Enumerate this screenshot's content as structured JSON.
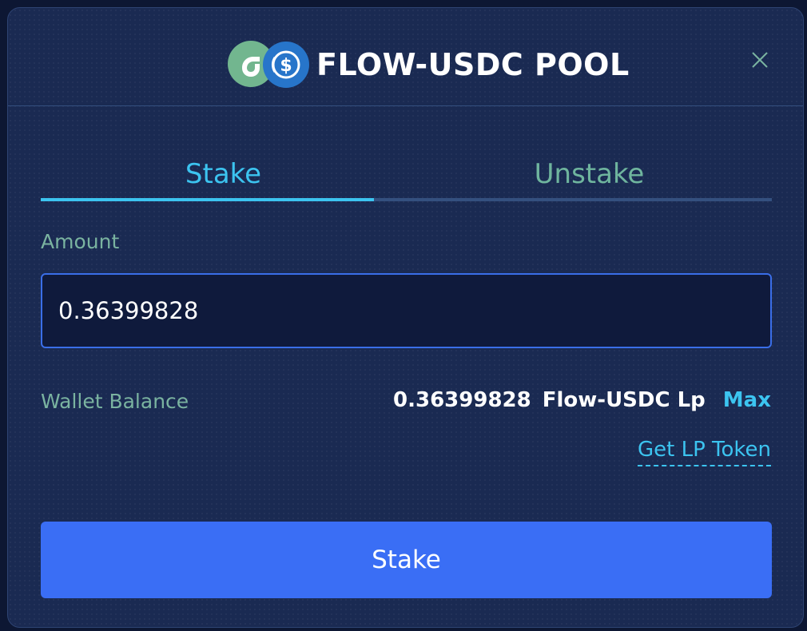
{
  "header": {
    "title": "FLOW-USDC POOL",
    "logos": [
      "flow-logo",
      "usdc-logo"
    ],
    "close_icon": "close-icon"
  },
  "tabs": [
    {
      "label": "Stake",
      "active": true
    },
    {
      "label": "Unstake",
      "active": false
    }
  ],
  "amount": {
    "label": "Amount",
    "value": "0.36399828"
  },
  "wallet": {
    "label": "Wallet Balance",
    "value": "0.36399828",
    "unit": "Flow-USDC Lp",
    "max_label": "Max"
  },
  "get_lp_label": "Get LP Token",
  "submit_label": "Stake",
  "colors": {
    "background": "#1a2a52",
    "accent": "#3cc4f0",
    "button": "#3a6ef5",
    "muted_green": "#7ab3a0",
    "flow_green": "#72b68f",
    "usdc_blue": "#2775ca"
  }
}
